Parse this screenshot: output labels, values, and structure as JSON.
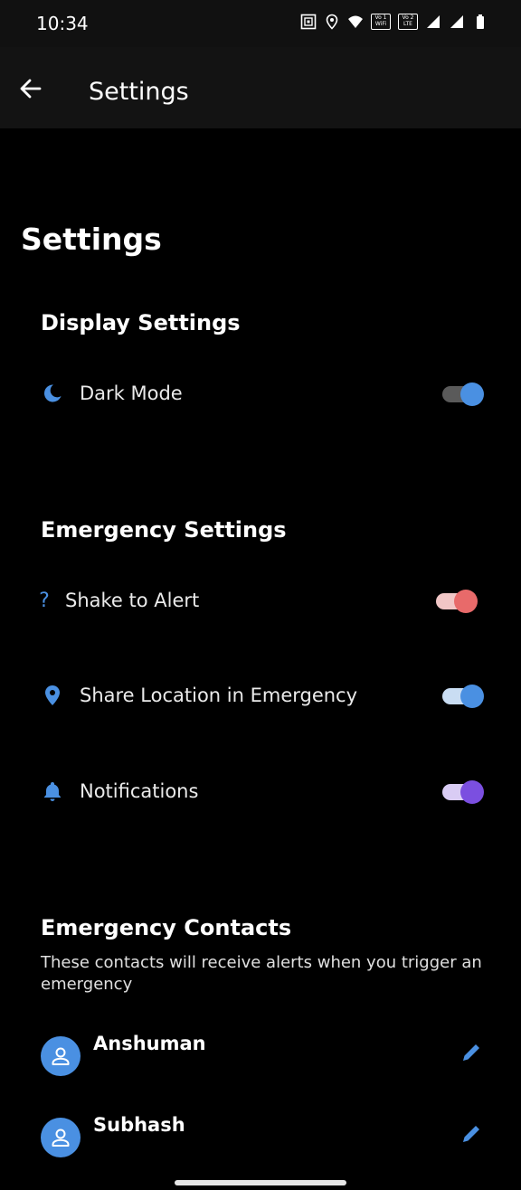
{
  "status_bar": {
    "time": "10:34",
    "icons": [
      "nfc-icon",
      "location-icon",
      "wifi-icon",
      "volte-wifi-icon",
      "volte-lte-icon",
      "signal-icon",
      "signal-icon",
      "battery-icon"
    ],
    "volte_wifi": "Vo 1 WiFi",
    "volte_lte": "Vo 2 LTE"
  },
  "app_bar": {
    "title": "Settings",
    "back_icon": "arrow-left-icon"
  },
  "page": {
    "title": "Settings"
  },
  "display_section": {
    "heading": "Display Settings",
    "items": [
      {
        "label": "Dark Mode",
        "icon": "moon-icon",
        "enabled": true,
        "color": "#4a90e2",
        "track": "#5a5a5a"
      }
    ]
  },
  "emergency_section": {
    "heading": "Emergency Settings",
    "items": [
      {
        "label": "Shake to Alert",
        "icon": "question-icon",
        "enabled": true,
        "color": "#e86a6a",
        "track": "#f1c6c6"
      },
      {
        "label": "Share Location in Emergency",
        "icon": "location-pin-icon",
        "enabled": true,
        "color": "#4a90e2",
        "track": "#c9ddf3"
      },
      {
        "label": "Notifications",
        "icon": "bell-icon",
        "enabled": true,
        "color": "#7b4fe0",
        "track": "#d9ccf4"
      }
    ]
  },
  "contacts_section": {
    "heading": "Emergency Contacts",
    "description": "These contacts will receive alerts when you trigger an emergency",
    "contacts": [
      {
        "name": "Anshuman"
      },
      {
        "name": "Subhash"
      }
    ]
  },
  "colors": {
    "accent": "#4a90e2",
    "background": "#000000",
    "app_bar": "#131313"
  }
}
